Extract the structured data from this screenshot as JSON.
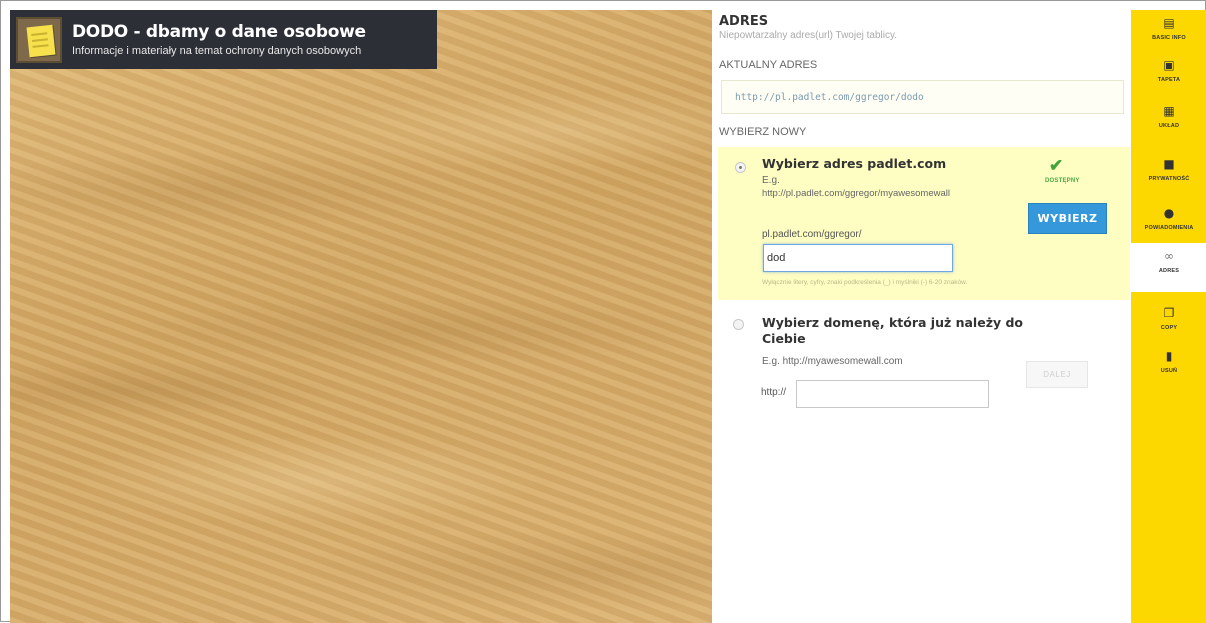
{
  "wall": {
    "title": "DODO - dbamy o dane osobowe",
    "subtitle": "Informacje i materiały na temat ochrony danych osobowych",
    "background": "sand"
  },
  "address_panel": {
    "title": "ADRES",
    "description": "Niepowtarzalny adres(url) Twojej tablicy.",
    "current_label": "AKTUALNY ADRES",
    "current_url": "http://pl.padlet.com/ggregor/dodo",
    "new_label": "WYBIERZ NOWY",
    "option_padlet": {
      "title": "Wybierz adres padlet.com",
      "example_label": "E.g.",
      "example_url": "http://pl.padlet.com/ggregor/myawesomewall",
      "status_icon": "check-icon",
      "status_text": "DOSTĘPNY",
      "button_label": "WYBIERZ",
      "prefix": "pl.padlet.com/ggregor/",
      "input_value": "dod",
      "hint": "Wyłącznie litery, cyfry, znaki podkreślenia (_) i myślniki (-) 6-20 znaków.",
      "selected": true
    },
    "option_domain": {
      "title": "Wybierz domenę, która już należy do Ciebie",
      "example": "E.g. http://myawesomewall.com",
      "prefix": "http://",
      "input_value": "",
      "button_label": "DALEJ",
      "selected": false
    }
  },
  "sidebar": {
    "items": [
      {
        "label": "BASIC INFO",
        "icon": "id-card-icon"
      },
      {
        "label": "TAPETA",
        "icon": "image-icon"
      },
      {
        "label": "UKŁAD",
        "icon": "layout-icon"
      },
      {
        "label": "PRYWATNOŚĆ",
        "icon": "lock-icon"
      },
      {
        "label": "POWIADOMIENIA",
        "icon": "eye-icon"
      },
      {
        "label": "ADRES",
        "icon": "link-icon",
        "active": true
      },
      {
        "label": "COPY",
        "icon": "copy-icon"
      },
      {
        "label": "USUŃ",
        "icon": "trash-icon"
      }
    ]
  },
  "colors": {
    "sidebar": "#fdd800",
    "accent": "#3498db",
    "header": "#2c2f36",
    "selected_option": "#fefdc2",
    "available": "#42a53b"
  }
}
